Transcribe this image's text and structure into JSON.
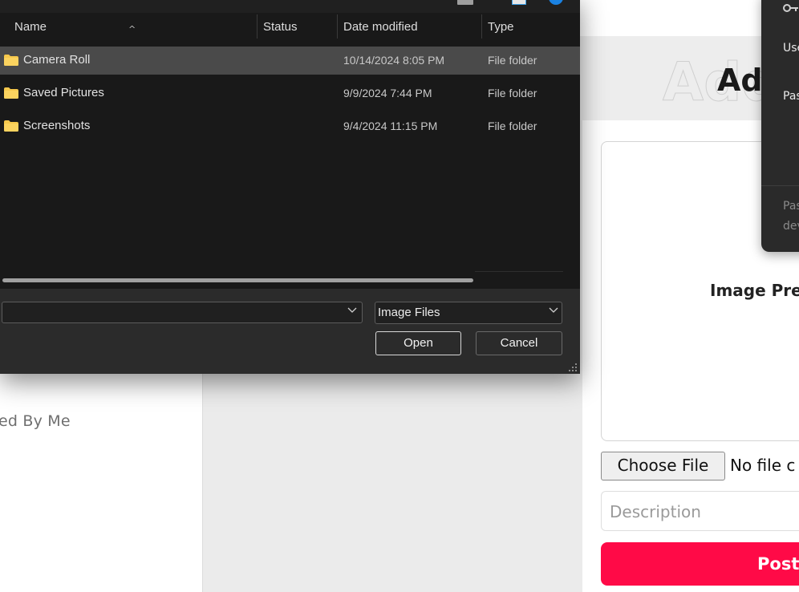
{
  "background_page": {
    "sidebar_partial_label": "ed By Me",
    "heading": "Add",
    "preview_label": "Image Pre",
    "choose_file_label": "Choose File",
    "no_file_text": "No file c",
    "description_placeholder": "Description",
    "post_label": "Post",
    "accent_color": "#ff0a47"
  },
  "password_popup": {
    "icon": "key-icon",
    "user_label": "Use",
    "password_label": "Pas",
    "footer_line1": "Pas",
    "footer_line2": "dev"
  },
  "file_dialog": {
    "columns": {
      "name": "Name",
      "status": "Status",
      "date_modified": "Date modified",
      "type": "Type"
    },
    "rows": [
      {
        "name": "Camera Roll",
        "status": "",
        "date": "10/14/2024 8:05 PM",
        "type": "File folder",
        "selected": true
      },
      {
        "name": "Saved Pictures",
        "status": "",
        "date": "9/9/2024 7:44 PM",
        "type": "File folder",
        "selected": false
      },
      {
        "name": "Screenshots",
        "status": "",
        "date": "9/4/2024 11:15 PM",
        "type": "File folder",
        "selected": false
      }
    ],
    "file_name_value": "",
    "file_type_filter": "Image Files",
    "open_label": "Open",
    "cancel_label": "Cancel",
    "folder_color": "#f6c84c"
  }
}
